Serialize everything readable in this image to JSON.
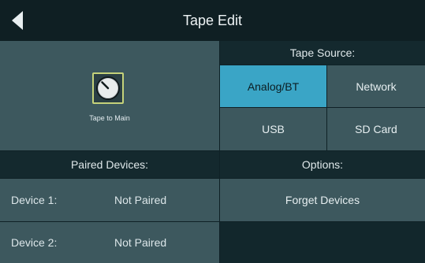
{
  "titlebar": {
    "title": "Tape Edit",
    "back_icon": "triangle-left-icon"
  },
  "knob": {
    "label": "Tape to Main"
  },
  "tape_source": {
    "header": "Tape Source:",
    "options": [
      "Analog/BT",
      "Network",
      "USB",
      "SD Card"
    ],
    "selected": "Analog/BT"
  },
  "paired_devices": {
    "header": "Paired Devices:",
    "devices": [
      {
        "label": "Device 1:",
        "status": "Not Paired"
      },
      {
        "label": "Device 2:",
        "status": "Not Paired"
      }
    ]
  },
  "options": {
    "header": "Options:",
    "forget_label": "Forget Devices"
  },
  "colors": {
    "active_accent": "#3aa5c6",
    "tile": "#3d585e",
    "header_bg": "#14292e",
    "knob_outline": "#c5d27a"
  }
}
